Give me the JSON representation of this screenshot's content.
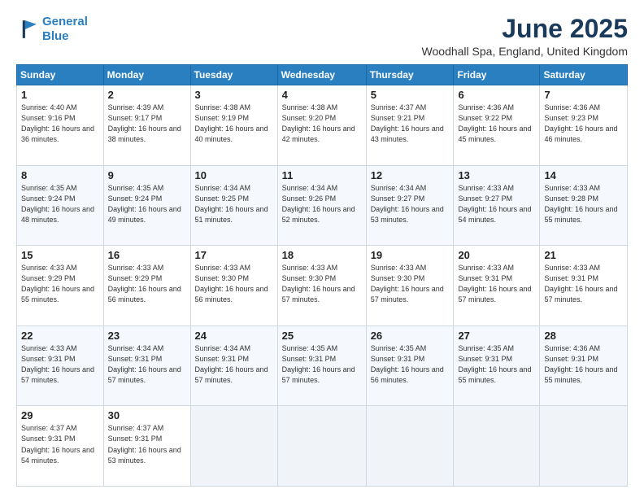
{
  "logo": {
    "line1": "General",
    "line2": "Blue"
  },
  "title": "June 2025",
  "subtitle": "Woodhall Spa, England, United Kingdom",
  "weekdays": [
    "Sunday",
    "Monday",
    "Tuesday",
    "Wednesday",
    "Thursday",
    "Friday",
    "Saturday"
  ],
  "weeks": [
    [
      {
        "day": "1",
        "sunrise": "4:40 AM",
        "sunset": "9:16 PM",
        "daylight": "16 hours and 36 minutes."
      },
      {
        "day": "2",
        "sunrise": "4:39 AM",
        "sunset": "9:17 PM",
        "daylight": "16 hours and 38 minutes."
      },
      {
        "day": "3",
        "sunrise": "4:38 AM",
        "sunset": "9:19 PM",
        "daylight": "16 hours and 40 minutes."
      },
      {
        "day": "4",
        "sunrise": "4:38 AM",
        "sunset": "9:20 PM",
        "daylight": "16 hours and 42 minutes."
      },
      {
        "day": "5",
        "sunrise": "4:37 AM",
        "sunset": "9:21 PM",
        "daylight": "16 hours and 43 minutes."
      },
      {
        "day": "6",
        "sunrise": "4:36 AM",
        "sunset": "9:22 PM",
        "daylight": "16 hours and 45 minutes."
      },
      {
        "day": "7",
        "sunrise": "4:36 AM",
        "sunset": "9:23 PM",
        "daylight": "16 hours and 46 minutes."
      }
    ],
    [
      {
        "day": "8",
        "sunrise": "4:35 AM",
        "sunset": "9:24 PM",
        "daylight": "16 hours and 48 minutes."
      },
      {
        "day": "9",
        "sunrise": "4:35 AM",
        "sunset": "9:24 PM",
        "daylight": "16 hours and 49 minutes."
      },
      {
        "day": "10",
        "sunrise": "4:34 AM",
        "sunset": "9:25 PM",
        "daylight": "16 hours and 51 minutes."
      },
      {
        "day": "11",
        "sunrise": "4:34 AM",
        "sunset": "9:26 PM",
        "daylight": "16 hours and 52 minutes."
      },
      {
        "day": "12",
        "sunrise": "4:34 AM",
        "sunset": "9:27 PM",
        "daylight": "16 hours and 53 minutes."
      },
      {
        "day": "13",
        "sunrise": "4:33 AM",
        "sunset": "9:27 PM",
        "daylight": "16 hours and 54 minutes."
      },
      {
        "day": "14",
        "sunrise": "4:33 AM",
        "sunset": "9:28 PM",
        "daylight": "16 hours and 55 minutes."
      }
    ],
    [
      {
        "day": "15",
        "sunrise": "4:33 AM",
        "sunset": "9:29 PM",
        "daylight": "16 hours and 55 minutes."
      },
      {
        "day": "16",
        "sunrise": "4:33 AM",
        "sunset": "9:29 PM",
        "daylight": "16 hours and 56 minutes."
      },
      {
        "day": "17",
        "sunrise": "4:33 AM",
        "sunset": "9:30 PM",
        "daylight": "16 hours and 56 minutes."
      },
      {
        "day": "18",
        "sunrise": "4:33 AM",
        "sunset": "9:30 PM",
        "daylight": "16 hours and 57 minutes."
      },
      {
        "day": "19",
        "sunrise": "4:33 AM",
        "sunset": "9:30 PM",
        "daylight": "16 hours and 57 minutes."
      },
      {
        "day": "20",
        "sunrise": "4:33 AM",
        "sunset": "9:31 PM",
        "daylight": "16 hours and 57 minutes."
      },
      {
        "day": "21",
        "sunrise": "4:33 AM",
        "sunset": "9:31 PM",
        "daylight": "16 hours and 57 minutes."
      }
    ],
    [
      {
        "day": "22",
        "sunrise": "4:33 AM",
        "sunset": "9:31 PM",
        "daylight": "16 hours and 57 minutes."
      },
      {
        "day": "23",
        "sunrise": "4:34 AM",
        "sunset": "9:31 PM",
        "daylight": "16 hours and 57 minutes."
      },
      {
        "day": "24",
        "sunrise": "4:34 AM",
        "sunset": "9:31 PM",
        "daylight": "16 hours and 57 minutes."
      },
      {
        "day": "25",
        "sunrise": "4:35 AM",
        "sunset": "9:31 PM",
        "daylight": "16 hours and 57 minutes."
      },
      {
        "day": "26",
        "sunrise": "4:35 AM",
        "sunset": "9:31 PM",
        "daylight": "16 hours and 56 minutes."
      },
      {
        "day": "27",
        "sunrise": "4:35 AM",
        "sunset": "9:31 PM",
        "daylight": "16 hours and 55 minutes."
      },
      {
        "day": "28",
        "sunrise": "4:36 AM",
        "sunset": "9:31 PM",
        "daylight": "16 hours and 55 minutes."
      }
    ],
    [
      {
        "day": "29",
        "sunrise": "4:37 AM",
        "sunset": "9:31 PM",
        "daylight": "16 hours and 54 minutes."
      },
      {
        "day": "30",
        "sunrise": "4:37 AM",
        "sunset": "9:31 PM",
        "daylight": "16 hours and 53 minutes."
      },
      null,
      null,
      null,
      null,
      null
    ]
  ]
}
